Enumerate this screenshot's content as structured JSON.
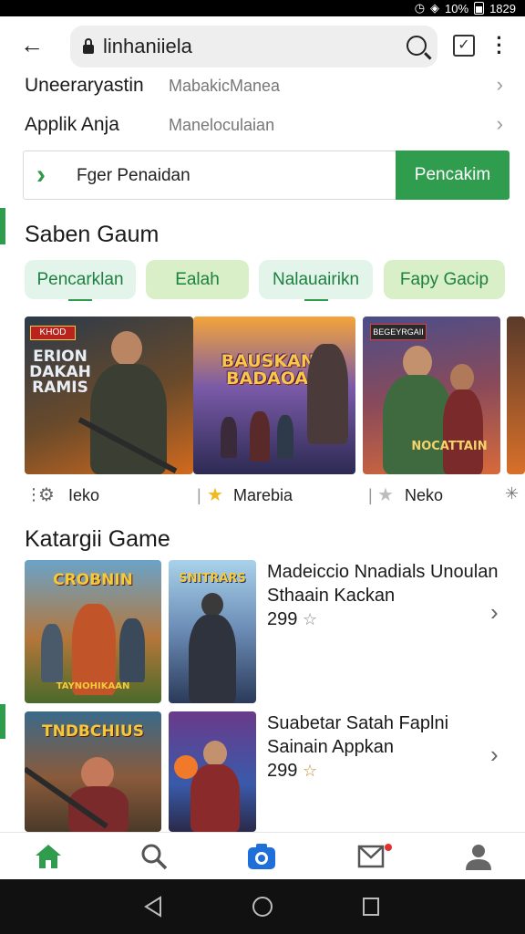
{
  "status_bar": {
    "battery": "10%",
    "time": "1829"
  },
  "browser": {
    "url": "linhaniiela",
    "url_placeholder": "linhaniiela"
  },
  "info_rows": [
    {
      "key": "Uneeraryastin",
      "value": "MabakicManea"
    },
    {
      "key": "Applik Anja",
      "value": "Maneloculaian"
    }
  ],
  "search": {
    "label": "Fger Penaidan",
    "button": "Pencakim"
  },
  "section1": {
    "title": "Saben Gaum"
  },
  "chips": [
    "Pencarklan",
    "Ealah",
    "Nalauairikn",
    "Fapy Gacip"
  ],
  "banner_cards": [
    {
      "art_text": "ERION DAKAH RAMIS",
      "tag": "KHOD"
    },
    {
      "art_text": "BAUSKANS BADAOAN",
      "tag": ""
    },
    {
      "art_text": "NOCATTAIN",
      "tag": "BEGEYRGAII"
    }
  ],
  "meta_row": [
    {
      "icon": "gear-icon",
      "label": "Ieko"
    },
    {
      "icon": "star-filled-icon",
      "label": "Marebia"
    },
    {
      "icon": "star-outline-icon",
      "label": "Neko"
    }
  ],
  "section2": {
    "title": "Katargii Game"
  },
  "games": [
    {
      "title": "Madeiccio Nnadials Unoulan Sthaain Kackan",
      "price": "299",
      "thumb1_text": "CROBNIN",
      "thumb1_sub": "TAYNOHIKAAN",
      "thumb2_text": "SNITRARS"
    },
    {
      "title": "Suabetar Satah Faplni Sainain Appkan",
      "price": "299",
      "thumb1_text": "TNDBCHIUS",
      "thumb1_sub": "",
      "thumb2_text": ""
    }
  ],
  "colors": {
    "accent": "#2f9d4d",
    "chip_bg_a": "#e3f4ea",
    "chip_bg_b": "#d8efc8",
    "nav_active": "#2f9d4d",
    "camera_blue": "#1e6fd9"
  }
}
